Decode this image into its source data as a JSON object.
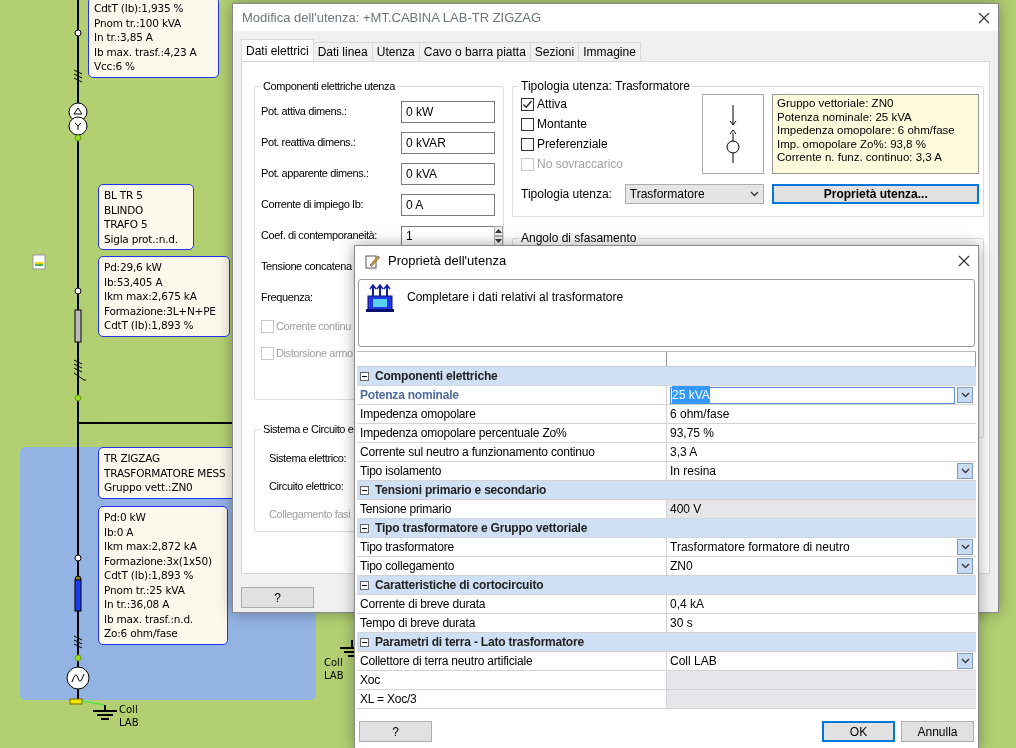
{
  "diagram": {
    "boxes": [
      {
        "lines": [
          "CdtT (Ib):1,935 %",
          "Pnom tr.:100 kVA",
          "In tr.:3,85 A",
          "Ib max. trasf.:4,23 A",
          "Vcc:6 %"
        ]
      },
      {
        "lines": [
          "BL TR 5",
          "BLINDO",
          "TRAFO 5",
          "Sigla prot.:n.d."
        ]
      },
      {
        "lines": [
          "Pd:29,6 kW",
          "Ib:53,405 A",
          "Ikm max:2,675 kA",
          "Formazione:3L+N+PE",
          "CdtT (Ib):1,893 %"
        ]
      },
      {
        "lines": [
          "TR ZIGZAG",
          "TRASFORMATORE MESS",
          "Gruppo vett.:ZN0"
        ]
      },
      {
        "lines": [
          "Pd:0 kW",
          "Ib:0 A",
          "Ikm max:2,872 kA",
          "Formazione:3x(1x50)",
          "CdtT (Ib):1,893 %",
          "Pnom tr.:25 kVA",
          "In tr.:36,08 A",
          "Ib max. trasf.:n.d.",
          "Zo:6 ohm/fase"
        ]
      }
    ],
    "ground_labels": [
      {
        "lines": [
          "Coll",
          "LAB"
        ]
      },
      {
        "lines": [
          "Coll",
          "LAB"
        ]
      }
    ]
  },
  "edit_dialog": {
    "title": "Modifica dell'utenza: +MT.CABINA LAB-TR ZIGZAG",
    "tabs": [
      {
        "label": "Dati elettrici",
        "selected": true
      },
      {
        "label": "Dati linea",
        "selected": false
      },
      {
        "label": "Utenza",
        "selected": false
      },
      {
        "label": "Cavo o barra piatta",
        "selected": false
      },
      {
        "label": "Sezioni",
        "selected": false
      },
      {
        "label": "Immagine",
        "selected": false
      }
    ],
    "components": {
      "title": "Componenti elettriche utenza",
      "fields": [
        {
          "kind": "input",
          "label": "Pot. attiva dimens.:",
          "value": "0 kW"
        },
        {
          "kind": "input",
          "label": "Pot. reattiva dimens.:",
          "value": "0 kVAR"
        },
        {
          "kind": "input",
          "label": "Pot. apparente dimens.:",
          "value": "0 kVA"
        },
        {
          "kind": "input",
          "label": "Corrente di impiego Ib:",
          "value": "0 A"
        },
        {
          "kind": "spin",
          "label": "Coef. di contemporaneità:",
          "value": "1"
        },
        {
          "kind": "label",
          "label": "Tensione concatena"
        },
        {
          "kind": "label",
          "label": "Frequenza:"
        },
        {
          "kind": "checkbox",
          "label": "Corrente continu",
          "checked": false,
          "disabled": true
        },
        {
          "kind": "checkbox",
          "label": "Distorsione armo",
          "checked": false,
          "disabled": true
        }
      ]
    },
    "type_group": {
      "title": "Tipologia utenza: Trasformatore",
      "checkboxes": [
        {
          "label": "Attiva",
          "checked": true,
          "disabled": false
        },
        {
          "label": "Montante",
          "checked": false,
          "disabled": false
        },
        {
          "label": "Preferenziale",
          "checked": false,
          "disabled": false
        },
        {
          "label": "No sovraccarico",
          "checked": false,
          "disabled": true
        }
      ],
      "info_lines": [
        "Gruppo vettoriale: ZN0",
        "Potenza nominale: 25 kVA",
        "Impedenza omopolare: 6 ohm/fase",
        "Imp. omopolare Zo%: 93,8 %",
        "Corrente n. funz. continuo: 3,3 A"
      ],
      "type_label": "Tipologia utenza:",
      "type_value": "Trasformatore",
      "props_button": "Proprietà utenza..."
    },
    "phase_group": {
      "title": "Angolo di sfasamento"
    },
    "system_group": {
      "title": "Sistema e Circuito e",
      "labels": [
        {
          "text": "Sistema elettrico:",
          "disabled": false
        },
        {
          "text": "Circuito elettrico:",
          "disabled": false
        },
        {
          "text": "Collegamento fasi",
          "disabled": true
        }
      ]
    },
    "help_button": "?"
  },
  "properties_dialog": {
    "title": "Proprietà dell'utenza",
    "message": "Completare i dati relativi al trasformatore",
    "rows": [
      {
        "kind": "section",
        "label": "Componenti elettriche"
      },
      {
        "kind": "row",
        "label": "Potenza nominale",
        "value": "25 kVA",
        "selected": true,
        "dropdown": true,
        "readonly": false
      },
      {
        "kind": "row",
        "label": "Impedenza omopolare",
        "value": "6 ohm/fase",
        "selected": false,
        "dropdown": false,
        "readonly": false
      },
      {
        "kind": "row",
        "label": "Impedenza omopolare percentuale Zo%",
        "value": "93,75 %",
        "selected": false,
        "dropdown": false,
        "readonly": false
      },
      {
        "kind": "row",
        "label": "Corrente sul neutro a funzionamento continuo",
        "value": "3,3 A",
        "selected": false,
        "dropdown": false,
        "readonly": false
      },
      {
        "kind": "row",
        "label": "Tipo isolamento",
        "value": "In resina",
        "selected": false,
        "dropdown": true,
        "readonly": false
      },
      {
        "kind": "section",
        "label": "Tensioni primario e secondario"
      },
      {
        "kind": "row",
        "label": "Tensione primario",
        "value": "400 V",
        "selected": false,
        "dropdown": false,
        "readonly": true
      },
      {
        "kind": "section",
        "label": "Tipo trasformatore e Gruppo vettoriale"
      },
      {
        "kind": "row",
        "label": "Tipo trasformatore",
        "value": "Trasformatore formatore di neutro",
        "selected": false,
        "dropdown": true,
        "readonly": false
      },
      {
        "kind": "row",
        "label": "Tipo collegamento",
        "value": "ZN0",
        "selected": false,
        "dropdown": true,
        "readonly": false
      },
      {
        "kind": "section",
        "label": "Caratteristiche di cortocircuito"
      },
      {
        "kind": "row",
        "label": "Corrente di breve durata",
        "value": "0,4 kA",
        "selected": false,
        "dropdown": false,
        "readonly": false
      },
      {
        "kind": "row",
        "label": "Tempo di breve durata",
        "value": "30 s",
        "selected": false,
        "dropdown": false,
        "readonly": false
      },
      {
        "kind": "section",
        "label": "Parametri di terra - Lato trasformatore"
      },
      {
        "kind": "row",
        "label": "Collettore di terra neutro artificiale",
        "value": "Coll LAB",
        "selected": false,
        "dropdown": true,
        "readonly": false
      },
      {
        "kind": "row",
        "label": "Xoc",
        "selected": false,
        "dropdown": false,
        "readonly": true
      },
      {
        "kind": "row",
        "label": "XL = Xoc/3",
        "selected": false,
        "dropdown": false,
        "readonly": true
      }
    ],
    "buttons": [
      {
        "label": "?",
        "kind": "help"
      },
      {
        "label": "OK",
        "kind": "default"
      },
      {
        "label": "Annulla",
        "kind": "cancel"
      }
    ]
  }
}
